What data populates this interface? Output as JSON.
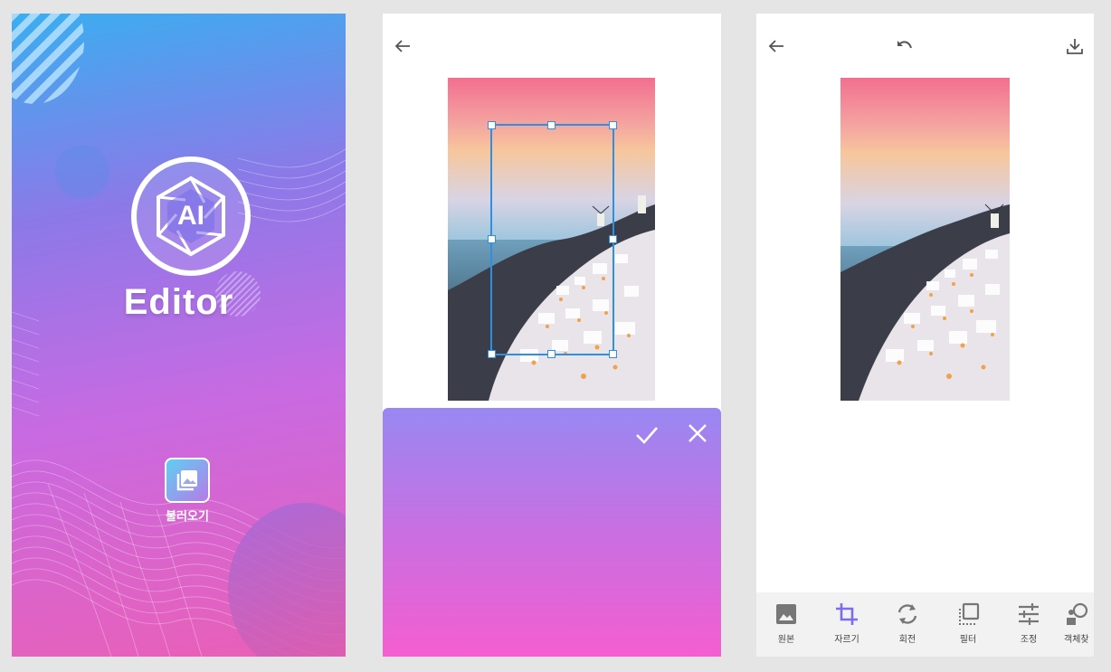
{
  "splash": {
    "logo_text": "AI",
    "app_name": "Editor",
    "load_label": "불러오기",
    "colors": {
      "gradient_top": "#3aaef0",
      "gradient_bottom": "#ea5fb6"
    }
  },
  "crop_screen": {
    "back_icon": "arrow-left-icon",
    "confirm_icon": "checkmark-icon",
    "cancel_icon": "close-icon",
    "colors": {
      "crop_frame": "#2f8fe0",
      "panel_top": "#9888f2",
      "panel_bottom": "#f45ed0"
    }
  },
  "edit_screen": {
    "back_icon": "arrow-left-icon",
    "undo_icon": "undo-icon",
    "download_icon": "download-icon",
    "tools": [
      {
        "label": "원본",
        "icon": "image-icon"
      },
      {
        "label": "자르기",
        "icon": "crop-icon"
      },
      {
        "label": "회전",
        "icon": "rotate-icon"
      },
      {
        "label": "필터",
        "icon": "filter-icon"
      },
      {
        "label": "조정",
        "icon": "sliders-icon"
      },
      {
        "label": "객체찾",
        "icon": "object-icon"
      }
    ],
    "colors": {
      "active_tool": "#7b6cf0",
      "tool_icon": "#777777"
    }
  }
}
